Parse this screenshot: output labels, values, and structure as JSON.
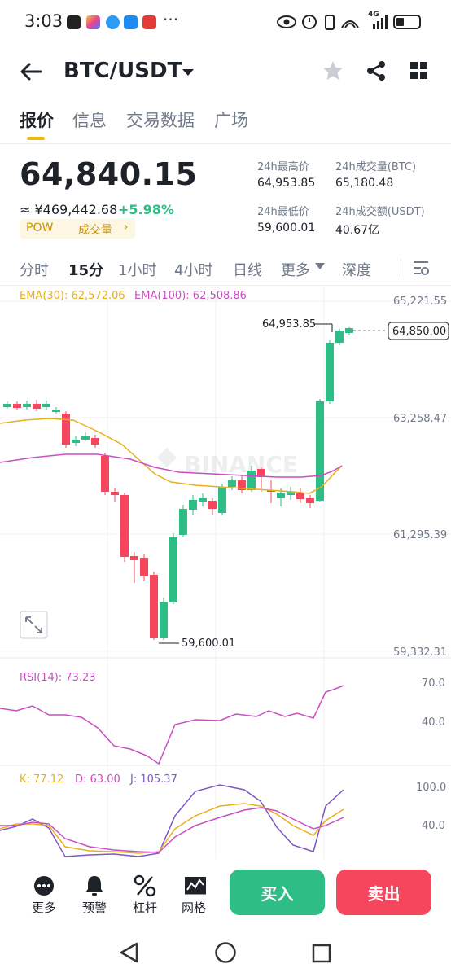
{
  "status_bar": {
    "time": "3:03",
    "dots": "···",
    "network": "4G"
  },
  "header": {
    "pair": "BTC/USDT"
  },
  "tabs": [
    {
      "label": "报价",
      "active": true
    },
    {
      "label": "信息",
      "active": false
    },
    {
      "label": "交易数据",
      "active": false
    },
    {
      "label": "广场",
      "active": false
    }
  ],
  "price": {
    "last": "64,840.15",
    "cny": "≈ ¥469,442.68",
    "change": "+5.98%",
    "tag1": "POW",
    "tag2": "成交量",
    "tag2_arrow": "›"
  },
  "stats": {
    "high_label": "24h最高价",
    "high": "64,953.85",
    "vol_btc_label": "24h成交量(BTC)",
    "vol_btc": "65,180.48",
    "low_label": "24h最低价",
    "low": "59,600.01",
    "vol_usdt_label": "24h成交额(USDT)",
    "vol_usdt": "40.67亿"
  },
  "timeframes": [
    "分时",
    "15分",
    "1小时",
    "4小时",
    "日线",
    "更多",
    "深度"
  ],
  "chart": {
    "ema30_label": "EMA(30): 62,572.06",
    "ema100_label": "EMA(100): 62,508.86",
    "axis": [
      "65,221.55",
      "63,258.47",
      "61,295.39",
      "59,332.31"
    ],
    "high_marker": "64,953.85",
    "low_marker": "59,600.01",
    "current": "64,850.00",
    "watermark": "BINANCE",
    "rsi_label": "RSI(14): 73.23",
    "rsi_axis": [
      "70.0",
      "40.0"
    ],
    "kdj_k": "K: 77.12",
    "kdj_d": "D: 63.00",
    "kdj_j": "J: 105.37",
    "kdj_axis": [
      "100.0",
      "40.0"
    ]
  },
  "bottom": {
    "more": "更多",
    "alert": "预警",
    "leverage": "杠杆",
    "grid": "网格",
    "buy": "买入",
    "sell": "卖出"
  },
  "colors": {
    "up": "#2ebd85",
    "down": "#f6465d",
    "accent": "#f0b90b",
    "ema30": "#e8b01a",
    "ema100": "#c94fc1"
  }
}
